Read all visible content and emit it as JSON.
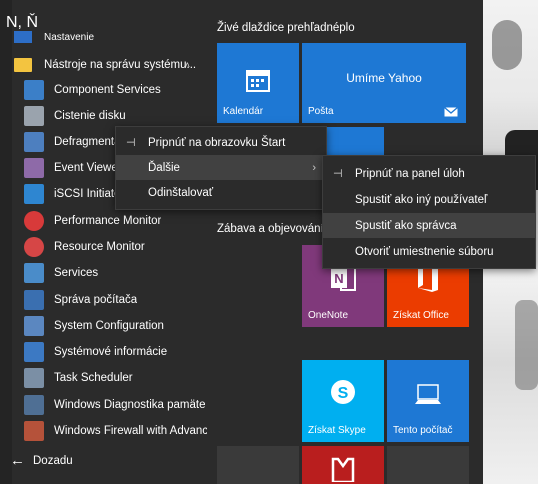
{
  "section_letter": "N, Ň",
  "clipped_item": "Nastavenie",
  "folder": {
    "label": "Nástroje na správu systému...",
    "chevron": "˄"
  },
  "apps": [
    {
      "label": "Component Services",
      "icon": "component-services-icon",
      "color": "#3b7fc8"
    },
    {
      "label": "Čistenie disku",
      "icon": "disk-cleanup-icon",
      "color": "#9aa3ad"
    },
    {
      "label": "Defragmentácia...",
      "icon": "defragment-icon",
      "color": "#4d7fbf"
    },
    {
      "label": "Event Viewer",
      "icon": "event-viewer-icon",
      "color": "#8e6aa8"
    },
    {
      "label": "iSCSI Initiator",
      "icon": "iscsi-icon",
      "color": "#2e86d1"
    },
    {
      "label": "Performance Monitor",
      "icon": "performance-monitor-icon",
      "color": "#d83a3a"
    },
    {
      "label": "Resource Monitor",
      "icon": "resource-monitor-icon",
      "color": "#d64646"
    },
    {
      "label": "Services",
      "icon": "services-gear-icon",
      "color": "#4a8cc9"
    },
    {
      "label": "Správa počítača",
      "icon": "computer-management-icon",
      "color": "#3a6fb0"
    },
    {
      "label": "System Configuration",
      "icon": "system-configuration-icon",
      "color": "#5b87c0"
    },
    {
      "label": "Systémové informácie",
      "icon": "system-information-icon",
      "color": "#3c79c3"
    },
    {
      "label": "Task Scheduler",
      "icon": "task-scheduler-icon",
      "color": "#7b8fa5"
    },
    {
      "label": "Windows Diagnostika pamäte",
      "icon": "memory-diagnostic-icon",
      "color": "#4f6f94"
    },
    {
      "label": "Windows Firewall with Advance...",
      "icon": "firewall-icon",
      "color": "#b5523a"
    }
  ],
  "back_label": "Dozadu",
  "groups": {
    "live": "Živé dlaždice prehľadnéplo",
    "fun": "Zábava a objevování"
  },
  "tiles": {
    "calendar": "Kalendár",
    "mail_big": "Umíme Yahoo",
    "mail": "Pošta",
    "onenote": "OneNote",
    "office": "Získat Office",
    "skype": "Získat Skype",
    "pc": "Tento počítač"
  },
  "colors": {
    "tile_blue": "#1e78d4",
    "onenote": "#80397b",
    "office": "#eb3c00",
    "skype": "#00aff0",
    "red_tile": "#b91e1e"
  },
  "context_menu": {
    "items": [
      {
        "label": "Pripnúť na obrazovku Štart",
        "icon": "pin-icon"
      },
      {
        "label": "Ďalšie",
        "submenu": "›"
      },
      {
        "label": "Odinštalovať"
      }
    ]
  },
  "submenu": {
    "items": [
      {
        "label": "Pripnúť na panel úloh",
        "icon": "pin-icon"
      },
      {
        "label": "Spustiť ako iný používateľ"
      },
      {
        "label": "Spustiť ako správca"
      },
      {
        "label": "Otvoriť umiestnenie súboru"
      }
    ]
  }
}
